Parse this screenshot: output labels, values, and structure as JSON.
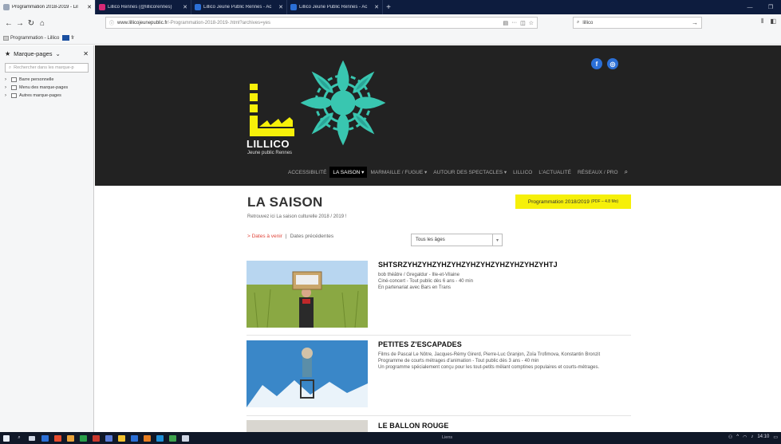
{
  "browser": {
    "tabs": [
      {
        "title": "Programmation 2018-2019 - Lil",
        "icon": "bookmark-page-icon",
        "color": "#9aa6b8"
      },
      {
        "title": "Lillico Rennes (@lillicorennes)",
        "icon": "instagram-icon",
        "color": "#d62976"
      },
      {
        "title": "Lillico Jeune Public Rennes - Ac",
        "icon": "facebook-icon",
        "color": "#2b6fd6"
      },
      {
        "title": "Lillico Jeune Public Rennes - Ac",
        "icon": "facebook-icon",
        "color": "#2b6fd6"
      }
    ],
    "url_host": "www.lillicojeunepublic.fr",
    "url_path": "/-Programmation-2018-2019-.html?archives=yes",
    "search_value": "lillico",
    "bookmarks_toolbar": [
      "Programmation - Lillico",
      "fr"
    ]
  },
  "sidebar": {
    "title": "Marque-pages",
    "search_placeholder": "Rechercher dans les marque-p",
    "items": [
      "Barre personnelle",
      "Menu des marque-pages",
      "Autres marque-pages"
    ]
  },
  "site": {
    "logo_text": "LILLICO",
    "logo_sub": "Jeune public Rennes",
    "menu": [
      {
        "label": "ACCESSIBILITÉ",
        "active": false
      },
      {
        "label": "LA SAISON ▾",
        "active": true
      },
      {
        "label": "MARMAILLE / FUGUE ▾",
        "active": false
      },
      {
        "label": "AUTOUR DES SPECTACLES ▾",
        "active": false
      },
      {
        "label": "LILLICO",
        "active": false
      },
      {
        "label": "L'ACTUALITÉ",
        "active": false
      },
      {
        "label": "RÉSEAUX / PRO",
        "active": false
      }
    ],
    "social": [
      "f",
      "◎"
    ],
    "colors": {
      "header_bg": "#222222",
      "yellow": "#f6f009",
      "accent_red": "#e0453a",
      "ornament": "#39c6b0"
    }
  },
  "main": {
    "title": "LA SAISON",
    "intro": "Retrouvez ici La saison culturelle 2018 / 2019 !",
    "dates_upcoming": "> Dates à venir",
    "dates_sep": "|",
    "dates_past": "Dates précédentes",
    "program_button": "Programmation 2018/2019",
    "program_button_small": "(PDF – 4.8 Mo)",
    "age_select": "Tous les âges",
    "shows": [
      {
        "title": "SHTSRZYHZYHZYHZYHZYHZYHZYHZYHZYHZYHTJ",
        "lines": [
          "bob théâtre / Gregaldur - Ille-et-Vilaine",
          "Ciné-concert - Tout public dès 6 ans - 40 min",
          "En partenariat avec Bars en Trans"
        ]
      },
      {
        "title": "PETITES Z'ESCAPADES",
        "lines": [
          "Films de Pascal Le Nôtre, Jacques-Rémy Girerd, Pierre-Luc Granjon, Zoïa Trofimova, Konstantin Bronzit",
          "Programme de courts métrages d'animation - Tout public dès 3 ans - 40 min",
          "Un programme spécialement conçu pour les tout-petits mêlant comptines populaires et courts-métrages."
        ]
      },
      {
        "title": "LE BALLON ROUGE",
        "lines": []
      }
    ]
  },
  "taskbar": {
    "middle": "Liens",
    "time": "14:10"
  }
}
